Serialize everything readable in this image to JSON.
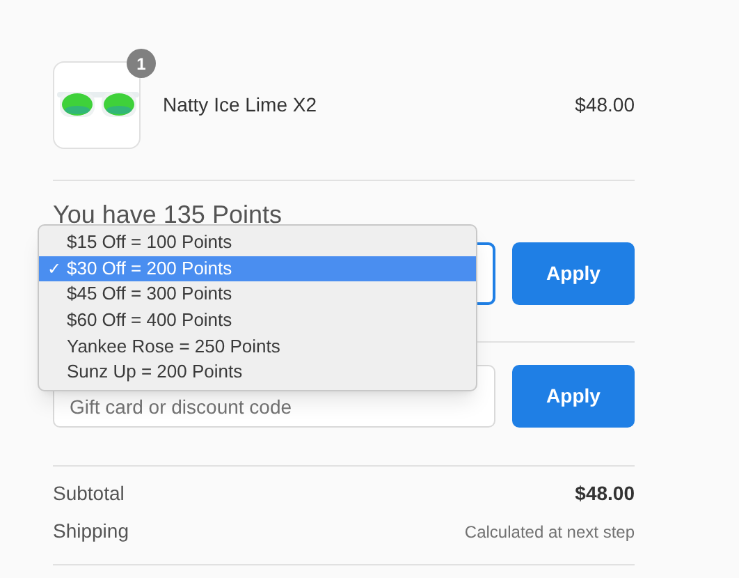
{
  "product": {
    "kind": "picture",
    "quantity": "1",
    "name": "Natty Ice Lime X2",
    "price": "$48.00"
  },
  "points": {
    "heading": "You have 135 Points",
    "button": "Apply",
    "menu": [
      {
        "label": "$15 Off = 100 Points",
        "selected": false
      },
      {
        "label": "$30 Off = 200 Points",
        "selected": true
      },
      {
        "label": "$45 Off = 300 Points",
        "selected": false
      },
      {
        "label": "$60 Off = 400 Points",
        "selected": false
      },
      {
        "label": "Yankee Rose = 250 Points",
        "selected": false
      },
      {
        "label": "Sunz Up = 200 Points",
        "selected": false
      }
    ],
    "check": "✓"
  },
  "discount": {
    "placeholder": "Gift card or discount code",
    "button": "Apply"
  },
  "summary": [
    {
      "label": "Subtotal",
      "value": "$48.00",
      "kind": "amount"
    },
    {
      "label": "Shipping",
      "value": "Calculated at next step",
      "kind": "note"
    }
  ]
}
